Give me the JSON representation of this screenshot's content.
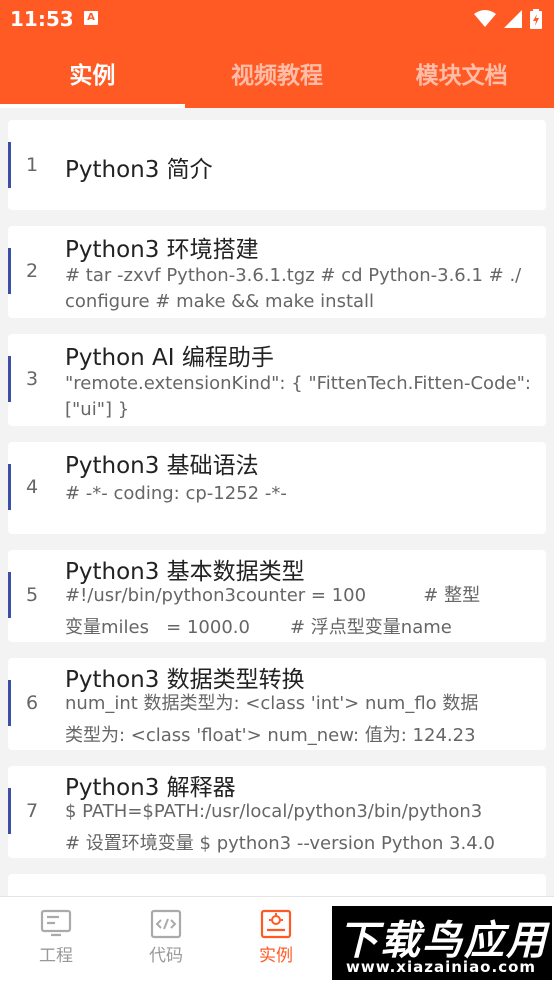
{
  "status_bar": {
    "time": "11:53",
    "app_icon_letter": "A"
  },
  "tabs": [
    {
      "label": "实例",
      "active": true
    },
    {
      "label": "视频教程",
      "active": false
    },
    {
      "label": "模块文档",
      "active": false
    }
  ],
  "items": [
    {
      "number": "1",
      "title": "Python3 简介",
      "desc": []
    },
    {
      "number": "2",
      "title": "Python3 环境搭建",
      "desc": [
        "# tar -zxvf Python-3.6.1.tgz # cd Python-3.6.1 # ./",
        "configure # make && make install"
      ]
    },
    {
      "number": "3",
      "title": "Python AI 编程助手",
      "desc": [
        "\"remote.extensionKind\": { \"FittenTech.Fitten-Code\":",
        "[\"ui\"] }"
      ]
    },
    {
      "number": "4",
      "title": "Python3 基础语法",
      "desc": [
        "# -*- coding: cp-1252 -*-"
      ]
    },
    {
      "number": "5",
      "title": "Python3 基本数据类型",
      "desc": [
        "#!/usr/bin/python3counter = 100          # 整型",
        "变量miles   = 1000.0       # 浮点型变量name"
      ]
    },
    {
      "number": "6",
      "title": "Python3 数据类型转换",
      "desc": [
        "num_int 数据类型为: <class 'int'> num_flo 数据",
        "类型为: <class 'float'> num_new: 值为: 124.23"
      ]
    },
    {
      "number": "7",
      "title": "Python3 解释器",
      "desc": [
        "$ PATH=$PATH:/usr/local/python3/bin/python3",
        "# 设置环境变量 $ python3 --version Python 3.4.0"
      ]
    }
  ],
  "bottom_nav": [
    {
      "label": "工程",
      "icon": "project-icon",
      "active": false
    },
    {
      "label": "代码",
      "icon": "code-icon",
      "active": false
    },
    {
      "label": "实例",
      "icon": "example-icon",
      "active": true
    }
  ],
  "watermark": {
    "title": "下载鸟应用",
    "url": "www.xiazainiao.com"
  }
}
